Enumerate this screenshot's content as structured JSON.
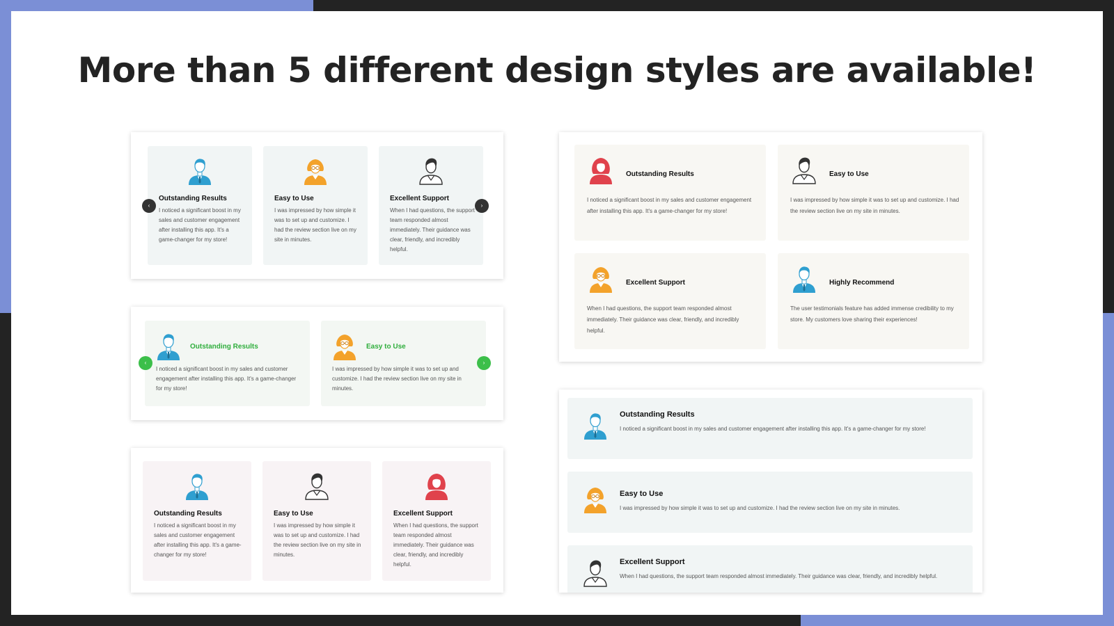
{
  "headline": "More than 5 different design styles are available!",
  "colors": {
    "accent": "#7b8fd6",
    "dark": "#232323",
    "blue": "#2f9fd0",
    "orange": "#f3a22b",
    "red": "#e0424c",
    "green": "#3cbf4a",
    "green_text": "#2fae3c"
  },
  "nav": {
    "prev": "‹",
    "next": "›"
  },
  "panel1": {
    "cards": [
      {
        "title": "Outstanding Results",
        "text": "I noticed a significant boost in my sales and customer engagement after installing this app. It's a game-changer for my store!",
        "icon": "male-avatar-blue-icon"
      },
      {
        "title": "Easy to Use",
        "text": "I was impressed by how simple it was to set up and customize. I had the review section live on my site in minutes.",
        "icon": "female-glasses-avatar-orange-icon"
      },
      {
        "title": "Excellent Support",
        "text": "When I had questions, the support team responded almost immediately. Their guidance was clear, friendly, and incredibly helpful.",
        "icon": "male-avatar-outline-icon"
      }
    ]
  },
  "panel2": {
    "cards": [
      {
        "title": "Outstanding Results",
        "text": "I noticed a significant boost in my sales and customer engagement after installing this app. It's a game-changer for my store!",
        "icon": "male-avatar-blue-icon"
      },
      {
        "title": "Easy to Use",
        "text": "I was impressed by how simple it was to set up and customize. I had the review section live on my site in minutes.",
        "icon": "female-glasses-avatar-orange-icon"
      }
    ]
  },
  "panel3": {
    "cards": [
      {
        "title": "Outstanding Results",
        "text": "I noticed a significant boost in my sales and customer engagement after installing this app. It's a game-changer for my store!",
        "icon": "male-avatar-blue-icon"
      },
      {
        "title": "Easy to Use",
        "text": "I was impressed by how simple it was to set up and customize. I had the review section live on my site in minutes.",
        "icon": "male-avatar-outline-icon"
      },
      {
        "title": "Excellent Support",
        "text": "When I had questions, the support team responded almost immediately. Their guidance was clear, friendly, and incredibly helpful.",
        "icon": "female-avatar-red-icon"
      }
    ]
  },
  "panel4": {
    "cards": [
      {
        "title": "Outstanding Results",
        "text": "I noticed a significant boost in my sales and customer engagement after installing this app. It's a game-changer for my store!",
        "icon": "female-avatar-red-icon"
      },
      {
        "title": "Easy to Use",
        "text": "I was impressed by how simple it was to set up and customize. I had the review section live on my site in minutes.",
        "icon": "male-avatar-outline-icon"
      },
      {
        "title": "Excellent Support",
        "text": "When I had questions, the support team responded almost immediately. Their guidance was clear, friendly, and incredibly helpful.",
        "icon": "female-glasses-avatar-orange-icon"
      },
      {
        "title": "Highly Recommend",
        "text": "The user testimonials feature has added immense credibility to my store. My customers love sharing their experiences!",
        "icon": "male-avatar-blue-icon"
      }
    ]
  },
  "panel5": {
    "cards": [
      {
        "title": "Outstanding Results",
        "text": "I noticed a significant boost in my sales and customer engagement after installing this app. It's a game-changer for my store!",
        "icon": "male-avatar-blue-icon"
      },
      {
        "title": "Easy to Use",
        "text": "I was impressed by how simple it was to set up and customize. I had the review section live on my site in minutes.",
        "icon": "female-glasses-avatar-orange-icon"
      },
      {
        "title": "Excellent Support",
        "text": "When I had questions, the support team responded almost immediately. Their guidance was clear, friendly, and incredibly helpful.",
        "icon": "male-avatar-outline-icon"
      }
    ]
  }
}
